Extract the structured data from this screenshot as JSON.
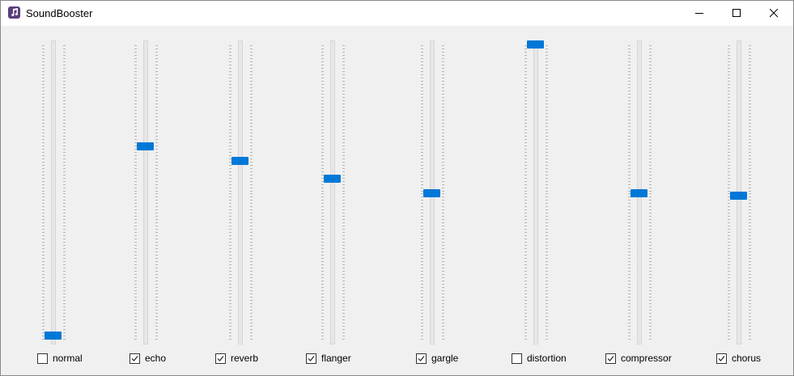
{
  "window": {
    "title": "SoundBooster"
  },
  "icons": {
    "app": "music-note-icon",
    "minimize": "minimize-icon",
    "maximize": "maximize-icon",
    "close": "close-icon",
    "checkmark": "checkmark-icon"
  },
  "colors": {
    "thumb": "#0078d7",
    "icon_bg": "#5b3f7a"
  },
  "effects": [
    {
      "name": "normal",
      "label": "normal",
      "checked": false,
      "level": 0.0
    },
    {
      "name": "echo",
      "label": "echo",
      "checked": true,
      "level": 0.65
    },
    {
      "name": "reverb",
      "label": "reverb",
      "checked": true,
      "level": 0.6
    },
    {
      "name": "flanger",
      "label": "flanger",
      "checked": true,
      "level": 0.54
    },
    {
      "name": "gargle",
      "label": "gargle",
      "checked": true,
      "level": 0.49
    },
    {
      "name": "distortion",
      "label": "distortion",
      "checked": false,
      "level": 1.0
    },
    {
      "name": "compressor",
      "label": "compressor",
      "checked": true,
      "level": 0.49
    },
    {
      "name": "chorus",
      "label": "chorus",
      "checked": true,
      "level": 0.48
    }
  ]
}
